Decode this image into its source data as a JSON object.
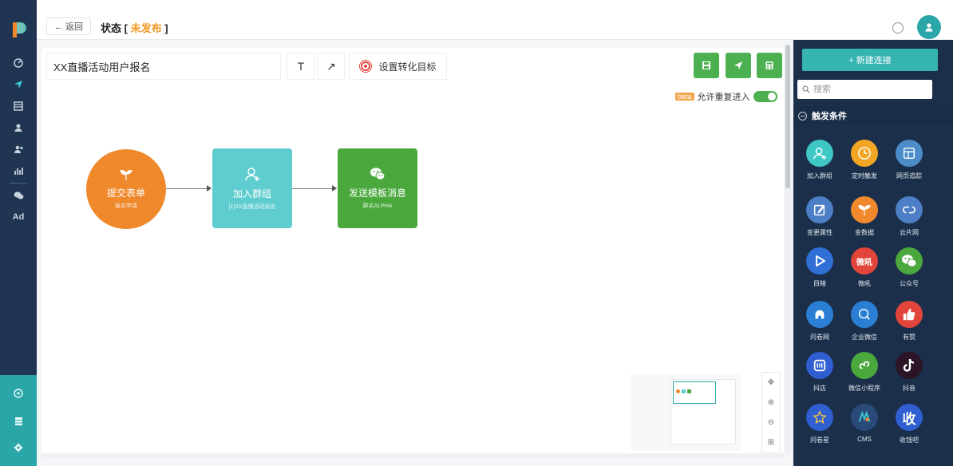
{
  "topbar": {
    "back_label": "← 返回",
    "status_prefix": "状态 [ ",
    "status_value": "未发布",
    "status_suffix": " ]"
  },
  "toolbar": {
    "journey_name": "XX直播活动用户报名",
    "text_tool": "T",
    "arrow_tool": "↗",
    "target_label": "设置转化目标"
  },
  "beta": {
    "tag": "beta",
    "label": "允许重复进入",
    "enabled": true
  },
  "flow": {
    "nodes": [
      {
        "title": "提交表单",
        "sub": "报名申请",
        "color": "#f0882c"
      },
      {
        "title": "加入群组",
        "sub": "[1]XX直播活动报名",
        "color": "#5fcdcf"
      },
      {
        "title": "发送模板消息",
        "sub": "群名ALPHA",
        "color": "#4aa83d"
      }
    ]
  },
  "panel": {
    "new_connection": "+ 新建连接",
    "search_placeholder": "搜索",
    "section_title": "触发条件",
    "triggers": [
      {
        "label": "加入群组",
        "color": "#3ec7c5",
        "icon": "user-add-icon"
      },
      {
        "label": "定时触发",
        "color": "#f3a624",
        "icon": "clock-icon"
      },
      {
        "label": "网页追踪",
        "color": "#4c8cc8",
        "icon": "webpage-icon"
      },
      {
        "label": "变更属性",
        "color": "#4d7fc6",
        "icon": "edit-icon"
      },
      {
        "label": "金数据",
        "color": "#f0882c",
        "icon": "jinshuju-icon"
      },
      {
        "label": "云片网",
        "color": "#4d7fc6",
        "icon": "yunpian-icon"
      },
      {
        "label": "目睹",
        "color": "#2f6fd6",
        "icon": "play-icon"
      },
      {
        "label": "微吼",
        "color": "#e0443a",
        "icon": "weihou-icon",
        "text": "微吼"
      },
      {
        "label": "公众号",
        "color": "#4aa83d",
        "icon": "wechat-icon"
      },
      {
        "label": "问卷网",
        "color": "#2a7fd4",
        "icon": "wenjuan-icon"
      },
      {
        "label": "企业微信",
        "color": "#2a7fd4",
        "icon": "wework-icon"
      },
      {
        "label": "有赞",
        "color": "#e0443a",
        "icon": "thumbs-up-icon"
      },
      {
        "label": "抖店",
        "color": "#2f5fd0",
        "icon": "doudian-icon"
      },
      {
        "label": "微信小程序",
        "color": "#4aa83d",
        "icon": "miniprogram-icon"
      },
      {
        "label": "抖音",
        "color": "#2a1426",
        "icon": "tiktok-icon"
      },
      {
        "label": "问卷星",
        "color": "#2f5fd0",
        "icon": "star-icon"
      },
      {
        "label": "CMS",
        "color": "#2a4a7a",
        "icon": "cms-icon"
      },
      {
        "label": "收钱吧",
        "color": "#2f5fd0",
        "icon": "shouqianba-icon",
        "text": "收"
      }
    ]
  },
  "sidebar": {
    "ad_label": "Ad"
  }
}
